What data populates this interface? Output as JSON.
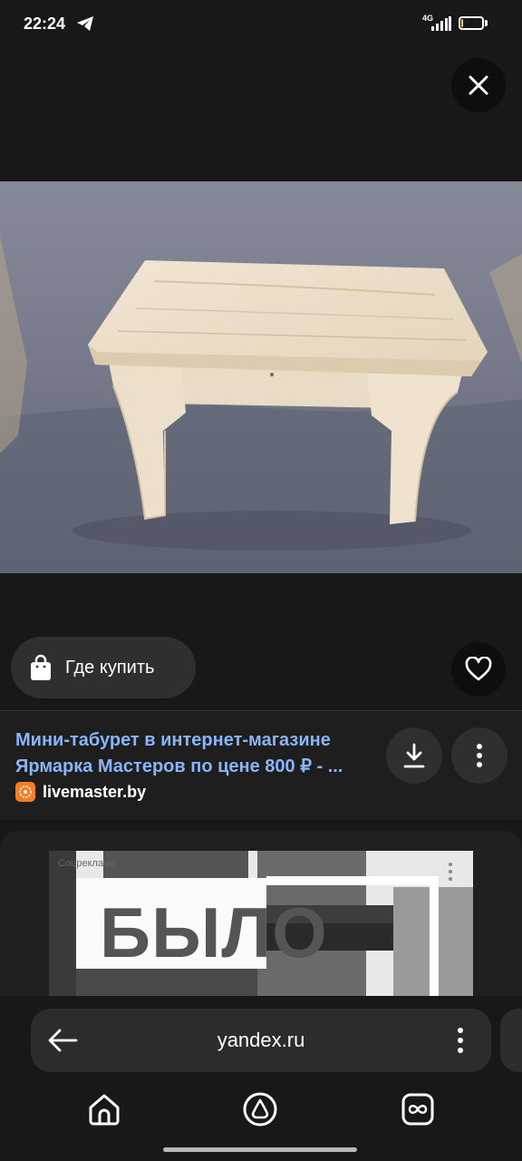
{
  "status_bar": {
    "time": "22:24",
    "network": "4G",
    "battery": "7",
    "battery_level": 0.07
  },
  "result": {
    "where_to_buy_label": "Где купить",
    "title_line1": "Мини-табурет в интернет-магазине",
    "title_line2": "Ярмарка Мастеров по цене 800 ₽ - ...",
    "source": "livemaster.by"
  },
  "ad": {
    "label": "Соцреклама",
    "headline": "БЫЛО"
  },
  "browser": {
    "url": "yandex.ru"
  },
  "icons": [
    "telegram-icon",
    "signal-icon",
    "battery-icon",
    "close-icon",
    "shopping-bag-icon",
    "heart-icon",
    "download-icon",
    "more-vertical-icon",
    "back-arrow-icon",
    "home-icon",
    "alice-icon",
    "tabs-icon"
  ],
  "colors": {
    "background": "#181818",
    "link_blue": "#8ab4f8",
    "button_bg": "#2f2f2f",
    "favicon_orange": "#f47f22"
  }
}
